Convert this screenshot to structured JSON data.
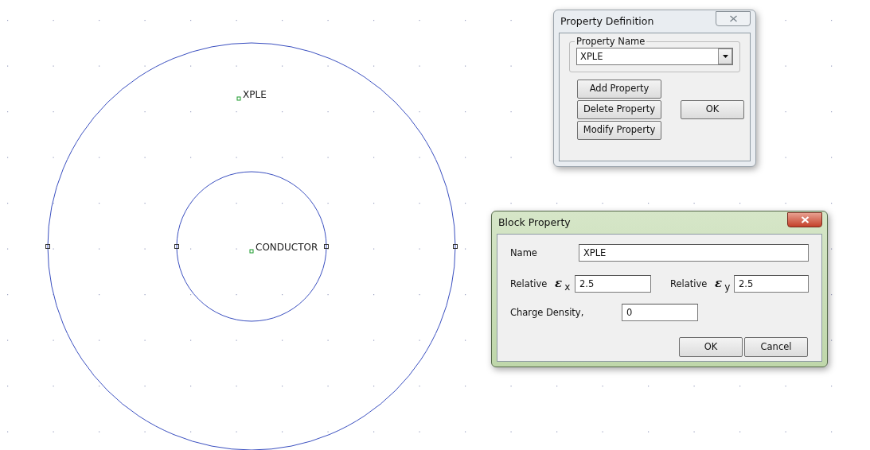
{
  "canvas": {
    "block_labels": [
      {
        "text": "XPLE"
      },
      {
        "text": "CONDUCTOR"
      }
    ]
  },
  "property_definition": {
    "title": "Property Definition",
    "active": false,
    "group_label": "Property Name",
    "property_name": "XPLE",
    "buttons": [
      {
        "label": "Add Property"
      },
      {
        "label": "Delete Property"
      },
      {
        "label": "Modify Property"
      }
    ],
    "ok": "OK"
  },
  "block_property": {
    "title": "Block Property",
    "active": true,
    "name_label": "Name",
    "name_value": "XPLE",
    "fields": [
      {
        "label": "Relative *ε*$_{x}$",
        "value": "2.5"
      },
      {
        "label": "Relative *ε*$_{y}$",
        "value": "2.5"
      },
      {
        "label": "Charge Density,",
        "value": "0"
      }
    ],
    "buttons": [
      {
        "label": "OK"
      },
      {
        "label": "Cancel"
      }
    ]
  }
}
